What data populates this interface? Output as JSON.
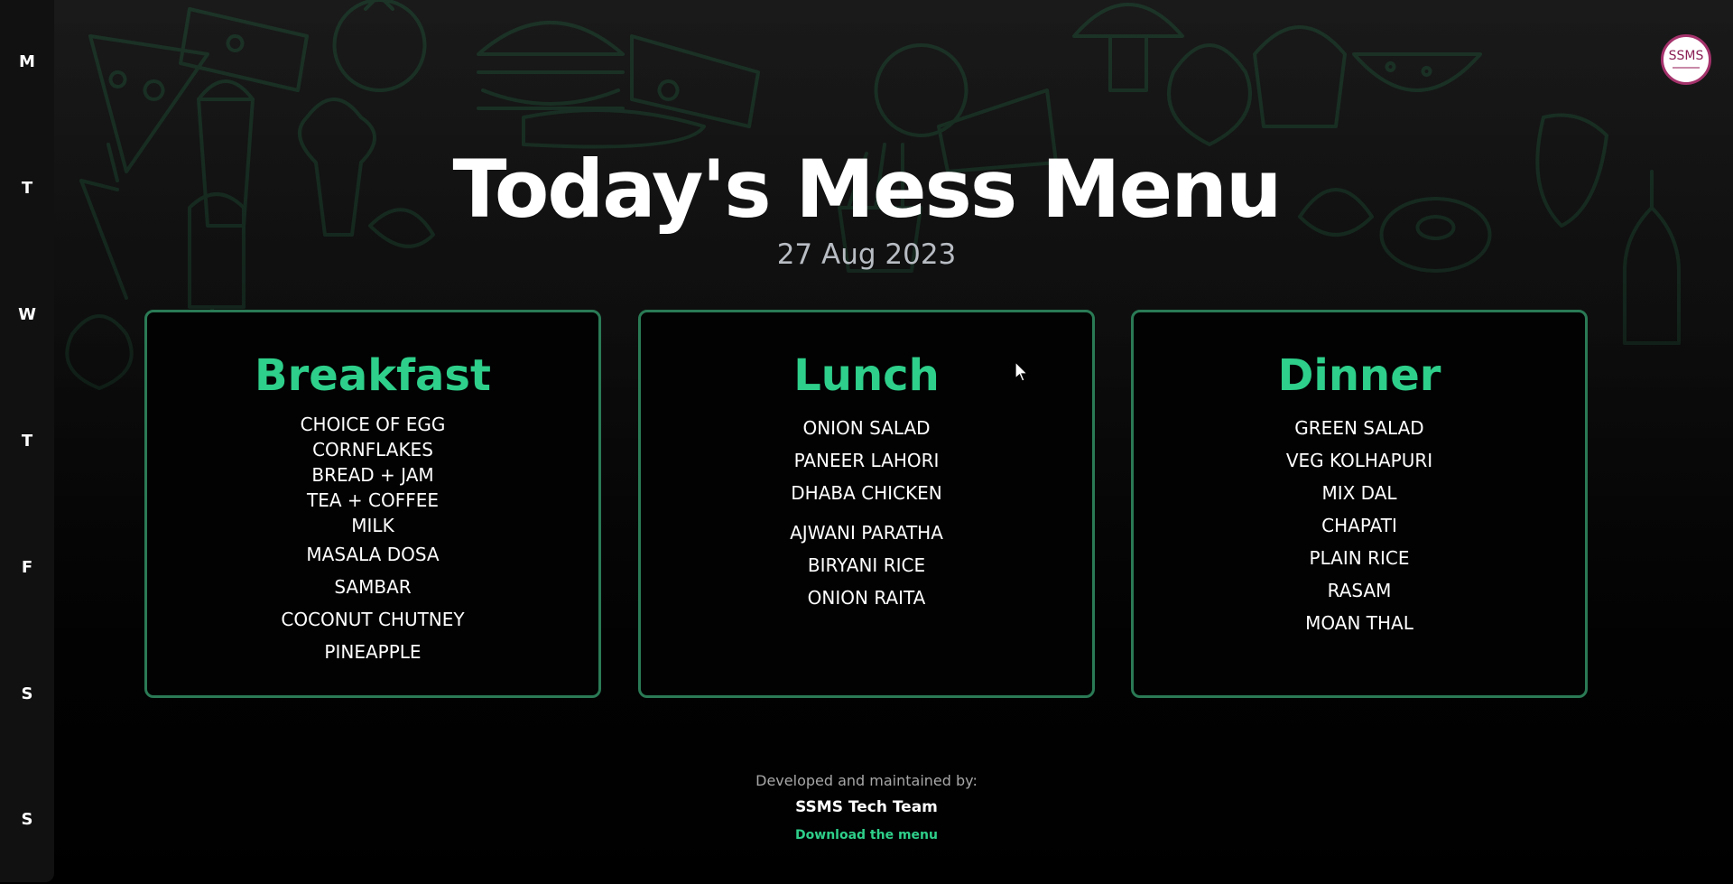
{
  "sidebar": {
    "items": [
      {
        "label": "M"
      },
      {
        "label": "T"
      },
      {
        "label": "W"
      },
      {
        "label": "T"
      },
      {
        "label": "F"
      },
      {
        "label": "S"
      },
      {
        "label": "S"
      }
    ]
  },
  "logo": {
    "text": "SSMS"
  },
  "header": {
    "title": "Today's Mess Menu",
    "date": "27 Aug 2023"
  },
  "meals": [
    {
      "title": "Breakfast",
      "items": [
        "CHOICE OF EGG",
        "CORNFLAKES",
        "BREAD + JAM",
        "TEA + COFFEE",
        "MILK",
        "MASALA DOSA",
        "SAMBAR",
        "COCONUT CHUTNEY",
        "PINEAPPLE"
      ]
    },
    {
      "title": "Lunch",
      "items": [
        "ONION SALAD",
        "PANEER LAHORI",
        "DHABA CHICKEN",
        "AJWANI PARATHA",
        "BIRYANI RICE",
        "ONION RAITA"
      ]
    },
    {
      "title": "Dinner",
      "items": [
        "GREEN SALAD",
        "VEG KOLHAPURI",
        "MIX DAL",
        "CHAPATI",
        "PLAIN RICE",
        "RASAM",
        "MOAN THAL"
      ]
    }
  ],
  "footer": {
    "developed_by": "Developed and maintained by:",
    "team": "SSMS Tech Team",
    "download_link": "Download the menu"
  },
  "colors": {
    "accent": "#2ecf8a",
    "card_border": "#2a7a55",
    "logo_ring": "#a4326b"
  }
}
